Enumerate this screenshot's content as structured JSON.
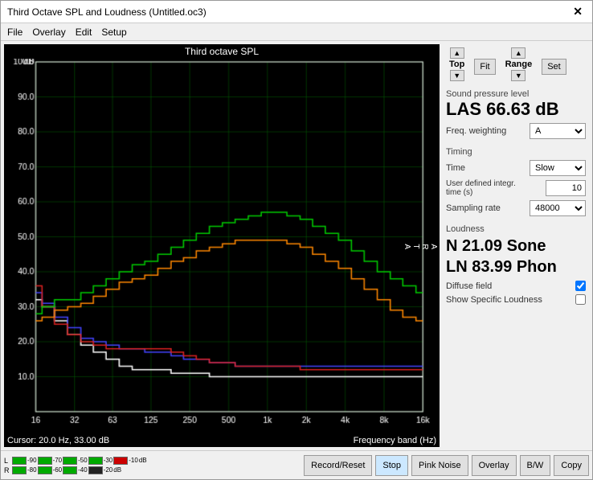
{
  "window": {
    "title": "Third Octave SPL and Loudness (Untitled.oc3)",
    "close_label": "✕"
  },
  "menu": {
    "items": [
      "File",
      "Overlay",
      "Edit",
      "Setup"
    ]
  },
  "chart": {
    "title": "Third octave SPL",
    "arta": "A\nR\nT\nA",
    "cursor_info": "Cursor:  20.0 Hz, 33.00 dB",
    "freq_label": "Frequency band (Hz)",
    "y_labels": [
      "100.0",
      "90.0",
      "80.0",
      "70.0",
      "60.0",
      "50.0",
      "40.0",
      "30.0",
      "20.0",
      "10.0"
    ],
    "x_labels": [
      "16",
      "32",
      "63",
      "125",
      "250",
      "500",
      "1k",
      "2k",
      "4k",
      "8k",
      "16k"
    ],
    "db_label": "dB"
  },
  "controls": {
    "top_label": "Top",
    "fit_label": "Fit",
    "range_label": "Range",
    "set_label": "Set"
  },
  "spl": {
    "section_label": "Sound pressure level",
    "value": "LAS 66.63 dB",
    "freq_weighting_label": "Freq. weighting",
    "freq_weighting_value": "A"
  },
  "timing": {
    "section_label": "Timing",
    "time_label": "Time",
    "time_value": "Slow",
    "user_defined_label": "User defined integr. time (s)",
    "user_defined_value": "10",
    "sampling_rate_label": "Sampling rate",
    "sampling_rate_value": "48000"
  },
  "loudness": {
    "section_label": "Loudness",
    "n_value": "N 21.09 Sone",
    "ln_value": "LN 83.99 Phon",
    "diffuse_field_label": "Diffuse field",
    "diffuse_field_checked": true,
    "show_specific_label": "Show Specific Loudness",
    "show_specific_checked": false
  },
  "bottom_bar": {
    "left_channel_label": "L",
    "right_channel_label": "R",
    "meter_ticks_L": [
      "-90",
      "-70",
      "-50",
      "-30",
      "-10",
      "dB"
    ],
    "meter_ticks_R": [
      "-80",
      "-60",
      "-40",
      "-20",
      "dB"
    ],
    "buttons": [
      "Record/Reset",
      "Stop",
      "Pink Noise",
      "Overlay",
      "B/W",
      "Copy"
    ]
  }
}
